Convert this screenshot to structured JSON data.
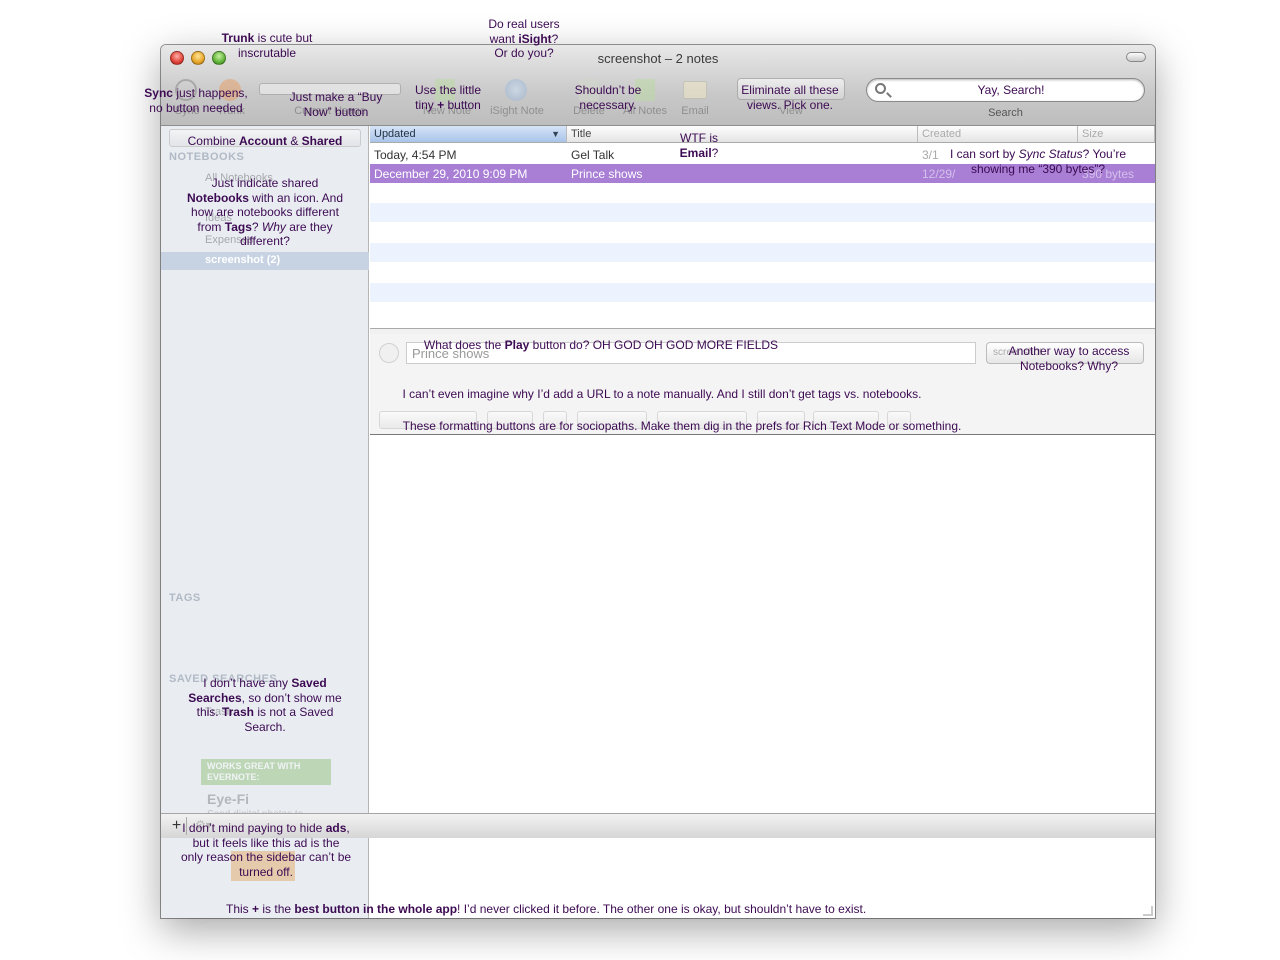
{
  "window": {
    "title": "screenshot – 2 notes"
  },
  "toolbar": {
    "sync_label": "Sync",
    "trunk_label": "Trunk",
    "current_usage_label": "Current Usage",
    "new_note_label": "New Note",
    "isight_note_label": "iSight Note",
    "delete_label": "Delete",
    "all_notes_label": "All Notes",
    "email_label": "Email",
    "view_label": "View",
    "search_label": "Search"
  },
  "sidebar": {
    "tab_account": "Account",
    "tab_shared": "Shared",
    "notebooks_header": "NOTEBOOKS",
    "items": [
      {
        "label": "All Notebooks"
      },
      {
        "label": "Ideas"
      },
      {
        "label": "Expenses"
      },
      {
        "label": "screenshot (2)"
      }
    ],
    "tags_header": "TAGS",
    "saved_searches_header": "SAVED SEARCHES",
    "trash_label": "Trash"
  },
  "ad": {
    "band": "WORKS GREAT WITH EVERNOTE:",
    "brand": "Eye-Fi",
    "sub": "Send digital photos to"
  },
  "note_list": {
    "col_updated": "Updated",
    "col_title": "Title",
    "col_created": "Created",
    "col_size": "Size",
    "rows": [
      {
        "updated": "Today, 4:54 PM",
        "title": "Gel Talk",
        "created": "3/1",
        "size": ""
      },
      {
        "updated": "December 29, 2010 9:09 PM",
        "title": "Prince shows",
        "created": "12/29/",
        "size": "390 bytes"
      }
    ]
  },
  "editor": {
    "title_value": "Prince shows",
    "notebook_value": "screenshot"
  },
  "annotations": {
    "trunk": {
      "b1": "Trunk",
      "t1": " is cute but inscrutable"
    },
    "isight": {
      "t1": "Do real users want ",
      "b1": "iSight",
      "t2": "? Or do you?"
    },
    "sync": {
      "b1": "Sync",
      "t1": " just happens, no button needed"
    },
    "buynow": {
      "t1": "Just make a “Buy Now” button"
    },
    "newnote": {
      "t1": "Use the little tiny ",
      "b1": "+",
      "t2": " button"
    },
    "delete": {
      "t1": "Shouldn’t be necessary."
    },
    "views": {
      "t1": "Eliminate all these views. Pick one."
    },
    "search": {
      "t1": "Yay, Search!"
    },
    "combine": {
      "t1": "Combine ",
      "b1": "Account",
      "t2": " & ",
      "b2": "Shared"
    },
    "email": {
      "t1": "WTF is ",
      "b1": "Email",
      "t2": "?"
    },
    "sort": {
      "t1": "I can sort by ",
      "i1": "Sync Status",
      "t2": "? You’re showing me “390 bytes”?"
    },
    "notebooks": {
      "t1": "Just indicate shared ",
      "b1": "Notebooks",
      "t2": " with an icon. And how are notebooks different from ",
      "b2": "Tags",
      "t3": "? ",
      "i1": "Why",
      "t4": " are they different?"
    },
    "play": {
      "t1": "What does the ",
      "b1": "Play",
      "t2": " button do? OH GOD OH GOD MORE FIELDS"
    },
    "access": {
      "t1": "Another way to access Notebooks? Why?"
    },
    "url": {
      "t1": "I can’t even imagine why I’d add a URL to a note manually. And I still don’t get tags vs. notebooks."
    },
    "format": {
      "t1": "These formatting buttons are for sociopaths. Make them dig in the prefs for Rich Text Mode or something."
    },
    "saved": {
      "t1": "I don’t have any ",
      "b1": "Saved Searches",
      "t2": ", so don’t show me this. ",
      "b2": "Trash",
      "t3": " is not a Saved Search."
    },
    "ads": {
      "t1": "I don’t mind paying to hide ",
      "b1": "ads",
      "t2": ", but it feels like this ad is the only reason the sidebar can’t be turned off."
    },
    "plus": {
      "t1": "This ",
      "b1": "+",
      "t2": " is the ",
      "b2": "best button in the whole app",
      "t3": "! I’d never clicked it before. The other one is okay, but shouldn’t have to exist."
    }
  },
  "colors": {
    "selection": "#a97fd6",
    "annotation_text": "#3c0a52",
    "alt_row": "#edf3fe"
  }
}
